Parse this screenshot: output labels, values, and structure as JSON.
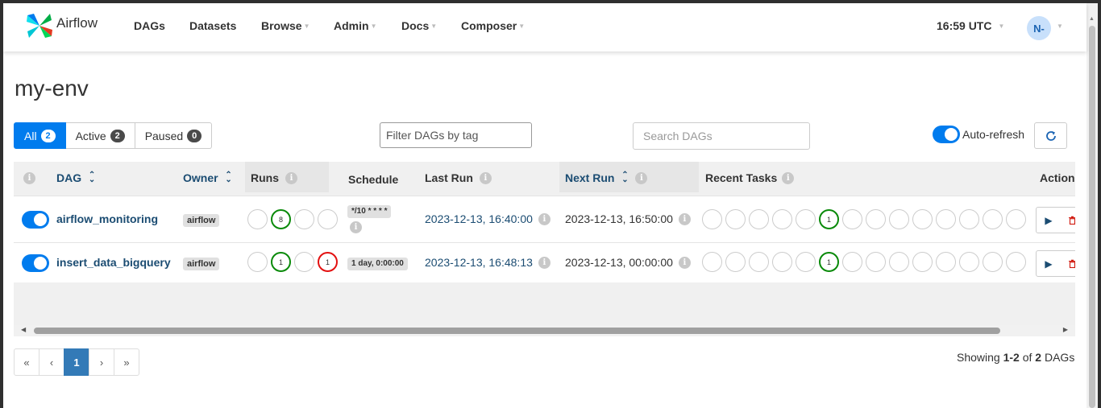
{
  "navbar": {
    "brand": "Airflow",
    "items": [
      {
        "label": "DAGs",
        "caret": false
      },
      {
        "label": "Datasets",
        "caret": false
      },
      {
        "label": "Browse",
        "caret": true
      },
      {
        "label": "Admin",
        "caret": true
      },
      {
        "label": "Docs",
        "caret": true
      },
      {
        "label": "Composer",
        "caret": true
      }
    ],
    "time": "16:59 UTC",
    "user_initials": "N-"
  },
  "page_title": "my-env",
  "status_filter": {
    "all": {
      "label": "All",
      "count": "2"
    },
    "active": {
      "label": "Active",
      "count": "2"
    },
    "paused": {
      "label": "Paused",
      "count": "0"
    }
  },
  "tag_filter_placeholder": "Filter DAGs by tag",
  "search_placeholder": "Search DAGs",
  "auto_refresh_label": "Auto-refresh",
  "table": {
    "headers": {
      "dag": "DAG",
      "owner": "Owner",
      "runs": "Runs",
      "schedule": "Schedule",
      "last_run": "Last Run",
      "next_run": "Next Run",
      "recent_tasks": "Recent Tasks",
      "actions": "Actions"
    },
    "rows": [
      {
        "dag_id": "airflow_monitoring",
        "owner": "airflow",
        "runs": [
          "",
          "8",
          "",
          ""
        ],
        "schedule": "*/10 * * * *",
        "last_run": "2023-12-13, 16:40:00",
        "next_run": "2023-12-13, 16:50:00",
        "recent_tasks_success": "1"
      },
      {
        "dag_id": "insert_data_bigquery",
        "owner": "airflow",
        "runs": [
          "",
          "1",
          "",
          "1"
        ],
        "schedule": "1 day, 0:00:00",
        "last_run": "2023-12-13, 16:48:13",
        "next_run": "2023-12-13, 00:00:00",
        "recent_tasks_success": "1"
      }
    ]
  },
  "pagination": {
    "first": "«",
    "prev": "‹",
    "current": "1",
    "next": "›",
    "last": "»"
  },
  "showing": {
    "prefix": "Showing ",
    "range": "1-2",
    "middle": " of ",
    "total": "2",
    "suffix": " DAGs"
  },
  "colors": {
    "accent": "#017cee",
    "success": "#0a8a0a",
    "failed": "#e31010",
    "link": "#1b4c72"
  }
}
